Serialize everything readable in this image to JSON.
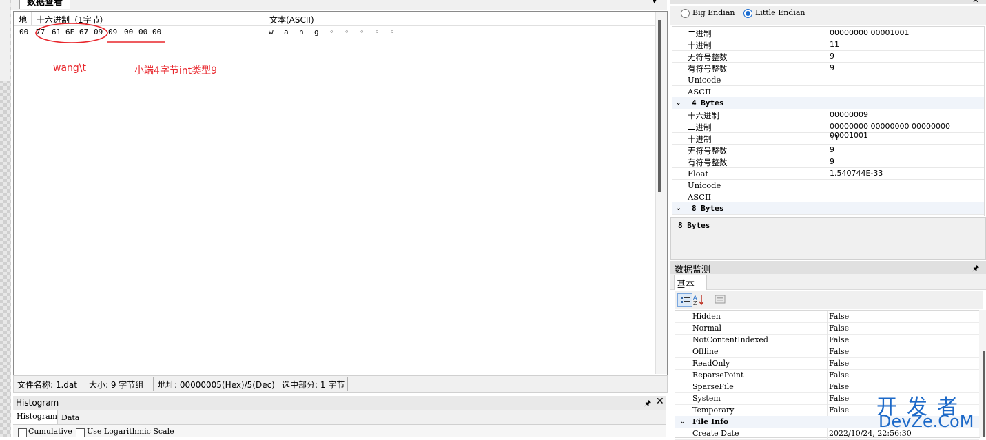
{
  "tab": {
    "title": "数据查看"
  },
  "hex_view": {
    "headers": {
      "addr": "地",
      "hex": "十六进制（1字节）",
      "text": "文本(ASCII)"
    },
    "row": {
      "addr": "00",
      "bytes": [
        "77",
        "61",
        "6E",
        "67",
        "09",
        "09",
        "00",
        "00",
        "00"
      ],
      "ascii": [
        "w",
        "a",
        "n",
        "g",
        "◦",
        "◦",
        "◦",
        "◦",
        "◦"
      ]
    },
    "annotations": {
      "first": "wang\\t",
      "second": "小端4字节int类型9"
    },
    "annotation_color": "#e8262c"
  },
  "status_bar": {
    "filename": "文件名称:    1.dat",
    "size": "大小:   9 字节组",
    "address": "地址:   00000005(Hex)/5(Dec)",
    "selection": "选中部分: 1 字节"
  },
  "histogram": {
    "title": "Histogram",
    "tabs": [
      "Histogram",
      "Data"
    ],
    "options": [
      "Cumulative",
      "Use Logarithmic Scale"
    ]
  },
  "data_inspector": {
    "endian": {
      "big": "Big Endian",
      "little": "Little Endian",
      "selected": "little"
    },
    "rows": [
      {
        "k": "二进制",
        "v": "00000000 00001001"
      },
      {
        "k": "十进制",
        "v": "11"
      },
      {
        "k": "无符号整数",
        "v": "9"
      },
      {
        "k": "有符号整数",
        "v": "9"
      },
      {
        "k": "Unicode",
        "v": ""
      },
      {
        "k": "ASCII",
        "v": ""
      },
      {
        "k": "4 Bytes",
        "v": "",
        "group": true
      },
      {
        "k": "十六进制",
        "v": "00000009"
      },
      {
        "k": "二进制",
        "v": "00000000 00000000 00000000 00001001"
      },
      {
        "k": "十进制",
        "v": "11"
      },
      {
        "k": "无符号整数",
        "v": "9"
      },
      {
        "k": "有符号整数",
        "v": "9"
      },
      {
        "k": "Float",
        "v": "1.540744E-33"
      },
      {
        "k": "Unicode",
        "v": ""
      },
      {
        "k": "ASCII",
        "v": ""
      },
      {
        "k": "8 Bytes",
        "v": "",
        "group": true
      }
    ],
    "description": "8 Bytes"
  },
  "data_monitor": {
    "title": "数据监测",
    "tab": "基本",
    "rows": [
      {
        "k": "Hidden",
        "v": "False"
      },
      {
        "k": "Normal",
        "v": "False"
      },
      {
        "k": "NotContentIndexed",
        "v": "False"
      },
      {
        "k": "Offline",
        "v": "False"
      },
      {
        "k": "ReadOnly",
        "v": "False"
      },
      {
        "k": "ReparsePoint",
        "v": "False"
      },
      {
        "k": "SparseFile",
        "v": "False"
      },
      {
        "k": "System",
        "v": "False"
      },
      {
        "k": "Temporary",
        "v": "False"
      },
      {
        "k": "File Info",
        "v": "",
        "group": true
      },
      {
        "k": "Create Date",
        "v": "2022/10/24, 22:56:30"
      }
    ]
  },
  "watermark": {
    "top": "开发者",
    "bottom": "DevZe.CoM"
  }
}
